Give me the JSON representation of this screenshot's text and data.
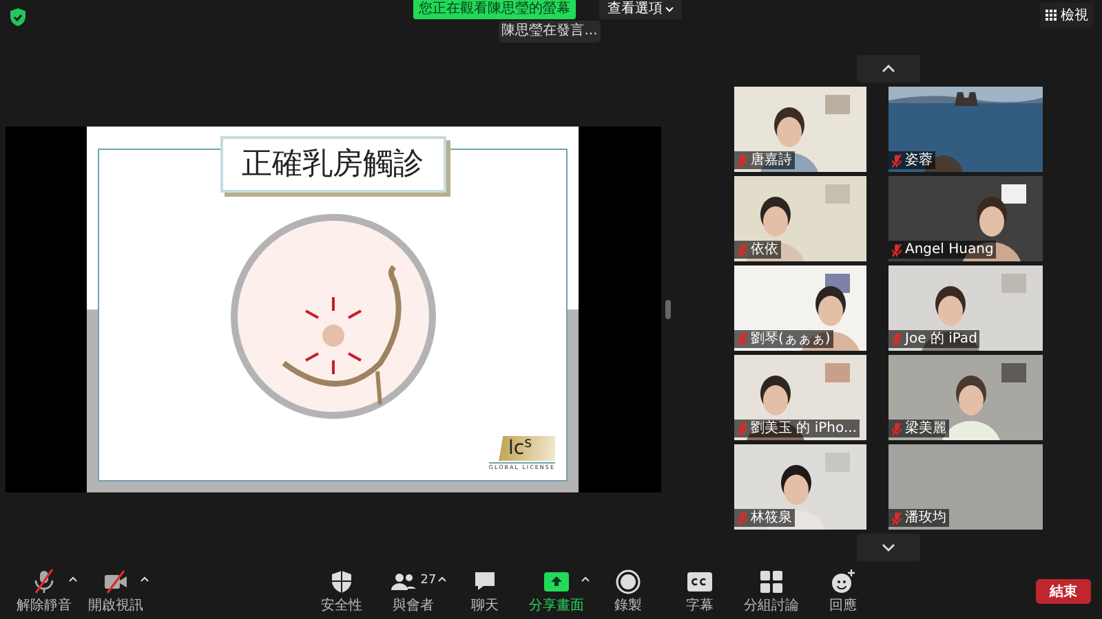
{
  "top_bar": {
    "banner": "您正在觀看陳思瑩的螢幕",
    "view_options": "查看選項",
    "speaker_tooltip": "陳思瑩在發言...",
    "view_button": "檢視"
  },
  "slide": {
    "title": "正確乳房觸診",
    "logo": "lc$^{s}$",
    "logo_caption": "GLOBAL LICENSE"
  },
  "participants": [
    {
      "name": "唐嘉詩",
      "muted": true
    },
    {
      "name": "姿蓉",
      "muted": true
    },
    {
      "name": "依依",
      "muted": true
    },
    {
      "name": "Angel Huang",
      "muted": true
    },
    {
      "name": "劉琴(ぁぁぁ)",
      "muted": true
    },
    {
      "name": "Joe 的 iPad",
      "muted": true
    },
    {
      "name": "劉美玉 的 iPho...",
      "muted": true
    },
    {
      "name": "梁美麗",
      "muted": true
    },
    {
      "name": "林筱泉",
      "muted": true
    },
    {
      "name": "潘玫均",
      "muted": true
    }
  ],
  "toolbar": [
    {
      "kind": "mic",
      "label": "解除靜音",
      "off": true,
      "menu": true
    },
    {
      "kind": "video",
      "label": "開啟視訊",
      "off": true,
      "menu": true
    },
    {
      "kind": "security",
      "label": "安全性",
      "menu": false
    },
    {
      "kind": "participants",
      "label": "與會者",
      "count": "27",
      "menu": true
    },
    {
      "kind": "chat",
      "label": "聊天",
      "menu": false
    },
    {
      "kind": "share",
      "label": "分享畫面",
      "active": true,
      "menu": true
    },
    {
      "kind": "record",
      "label": "錄製",
      "menu": false
    },
    {
      "kind": "captions",
      "label": "字幕",
      "menu": false
    },
    {
      "kind": "breakout",
      "label": "分組討論",
      "menu": false
    },
    {
      "kind": "reactions",
      "label": "回應",
      "menu": false
    }
  ],
  "end_button": "結束"
}
